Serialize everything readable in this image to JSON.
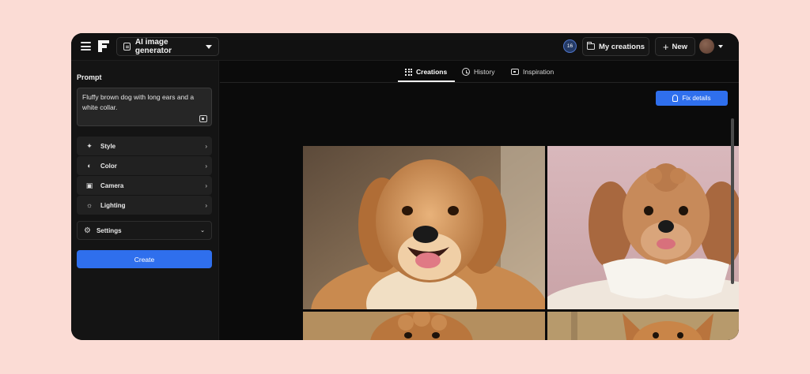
{
  "app": {
    "tool_selector": "AI image generator",
    "credits_badge": "16",
    "my_creations_label": "My creations",
    "new_label": "New"
  },
  "sidebar": {
    "prompt_label": "Prompt",
    "prompt_text": "Fluffy brown dog with long ears and a white collar.",
    "options": [
      {
        "label": "Style",
        "icon": "style-icon"
      },
      {
        "label": "Color",
        "icon": "palette-icon"
      },
      {
        "label": "Camera",
        "icon": "camera-icon"
      },
      {
        "label": "Lighting",
        "icon": "sun-icon"
      }
    ],
    "settings_label": "Settings",
    "create_label": "Create"
  },
  "main": {
    "tabs": [
      {
        "label": "Creations",
        "icon": "grid-icon",
        "active": true
      },
      {
        "label": "History",
        "icon": "history-icon",
        "active": false
      },
      {
        "label": "Inspiration",
        "icon": "inspiration-icon",
        "active": false
      }
    ],
    "fix_details_label": "Fix details",
    "images": [
      "golden retriever puppy smiling",
      "curly poodle with white ruffled collar",
      "curly brown dog (partially visible)",
      "chihuahua with pointed ears (partially visible)"
    ]
  },
  "colors": {
    "page_background": "#fbdcd5",
    "window_background": "#0c0c0c",
    "accent": "#2f6fed"
  }
}
